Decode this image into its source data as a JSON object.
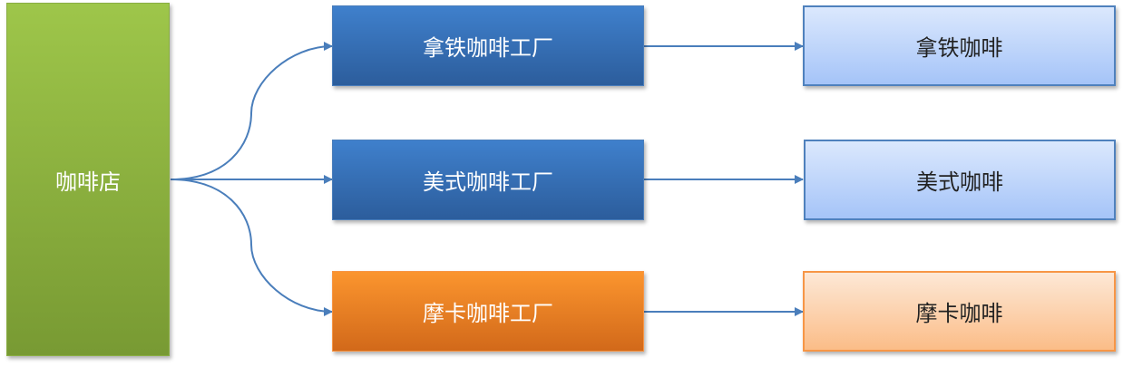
{
  "root": {
    "label": "咖啡店"
  },
  "factories": [
    {
      "label": "拿铁咖啡工厂",
      "color": "#3f80cc"
    },
    {
      "label": "美式咖啡工厂",
      "color": "#3f80cc"
    },
    {
      "label": "摩卡咖啡工厂",
      "color": "#fb952e"
    }
  ],
  "products": [
    {
      "label": "拿铁咖啡"
    },
    {
      "label": "美式咖啡"
    },
    {
      "label": "摩卡咖啡"
    }
  ],
  "arrow_color": "#4a7ebb"
}
